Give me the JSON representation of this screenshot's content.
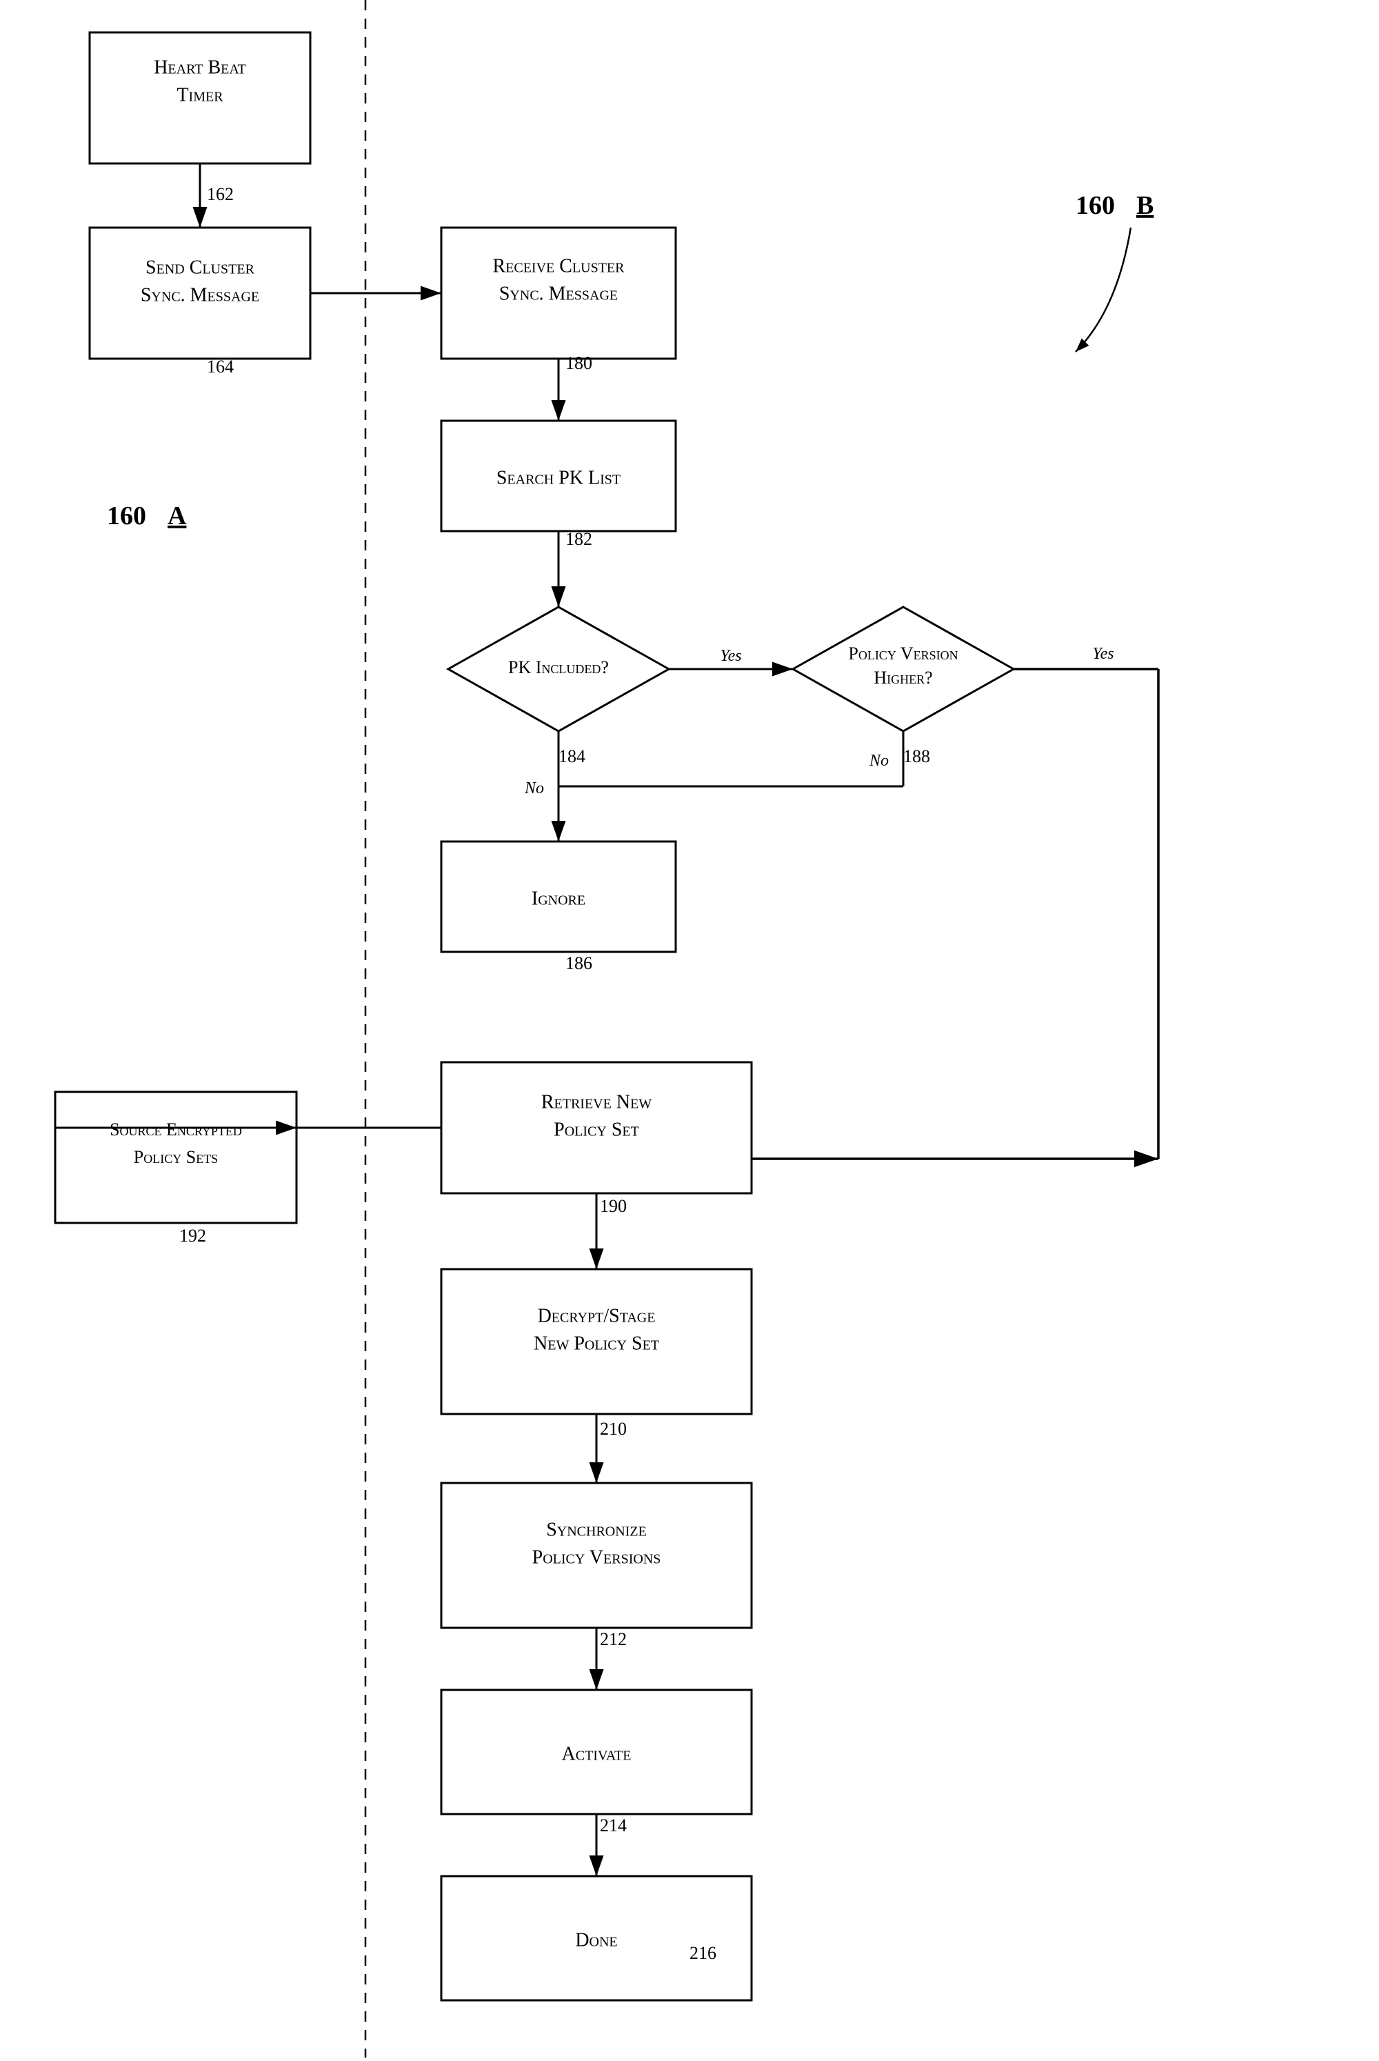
{
  "diagram": {
    "title": "Flowchart 160A and 160B",
    "nodes": {
      "heartbeat": {
        "label": "Heart Beat\nTimer",
        "ref": "162"
      },
      "send_cluster": {
        "label": "Send Cluster\nSync. Message",
        "ref": "164"
      },
      "receive_cluster": {
        "label": "Receive Cluster\nSync. Message",
        "ref": "180"
      },
      "search_pk": {
        "label": "Search PK List",
        "ref": "182"
      },
      "pk_included": {
        "label": "PK Included?",
        "ref": "184"
      },
      "policy_version": {
        "label": "Policy Version\nHigher?",
        "ref": "188"
      },
      "ignore": {
        "label": "Ignore",
        "ref": "186"
      },
      "retrieve_new": {
        "label": "Retrieve New\nPolicy Set",
        "ref": "190"
      },
      "source_encrypted": {
        "label": "Source Encrypted\nPolicy Sets",
        "ref": "192"
      },
      "decrypt_stage": {
        "label": "Decrypt/Stage\nNew Policy Set",
        "ref": "210"
      },
      "synchronize": {
        "label": "Synchronize\nPolicy Versions",
        "ref": "212"
      },
      "activate": {
        "label": "Activate",
        "ref": "214"
      },
      "done": {
        "label": "Done",
        "ref": "216"
      }
    },
    "labels": {
      "160a": "160A",
      "160b": "160B",
      "yes": "Yes",
      "no": "No"
    }
  }
}
